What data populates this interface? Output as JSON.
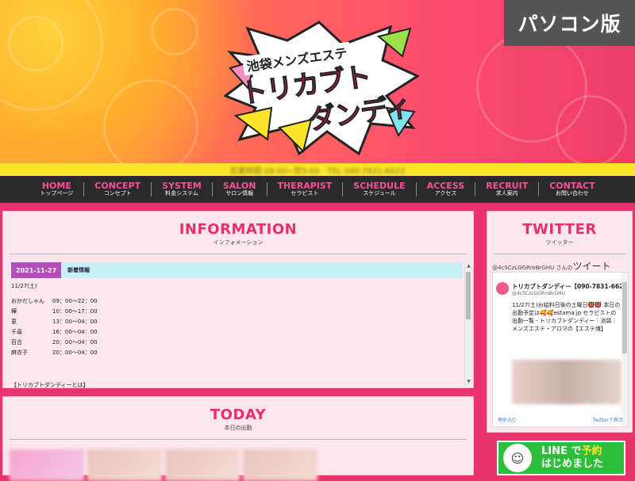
{
  "header": {
    "pc_badge": "パソコン版",
    "logo_sub": "池袋メンズエステ",
    "logo_line1": "トリカブト",
    "logo_line2": "ダンディ",
    "yellow_bar_text": "営業時間 09:00~翌5:00　TEL 090-7831-6622"
  },
  "nav": [
    {
      "en": "HOME",
      "ja": "トップページ"
    },
    {
      "en": "CONCEPT",
      "ja": "コンセプト"
    },
    {
      "en": "SYSTEM",
      "ja": "料金システム"
    },
    {
      "en": "SALON",
      "ja": "サロン情報"
    },
    {
      "en": "THERAPIST",
      "ja": "セラピスト"
    },
    {
      "en": "SCHEDULE",
      "ja": "スケジュール"
    },
    {
      "en": "ACCESS",
      "ja": "アクセス"
    },
    {
      "en": "RECRUIT",
      "ja": "求人案内"
    },
    {
      "en": "CONTACT",
      "ja": "お問い合わせ"
    }
  ],
  "information": {
    "title": "INFORMATION",
    "subtitle": "インフォメーション",
    "news_date": "2021-11-27",
    "news_category": "新着情報",
    "date_line": "11/27(土)",
    "shifts": [
      {
        "name": "おかだしゃん",
        "time": "09：00～22：00"
      },
      {
        "name": "樺",
        "time": "10：00～17：00"
      },
      {
        "name": "恵",
        "time": "13：00～04：00"
      },
      {
        "name": "千尋",
        "time": "16：00～04：00"
      },
      {
        "name": "百合",
        "time": "20：00～04：00"
      },
      {
        "name": "麻衣子",
        "time": "20：00～04：00"
      }
    ],
    "footer_line": "【トリカブトダンディーとは】"
  },
  "today": {
    "title": "TODAY",
    "subtitle": "本日の出勤"
  },
  "twitter": {
    "title": "TWITTER",
    "subtitle": "ツイッター",
    "header_handle": "@4cSCzLGGRmBrGHU さんの",
    "header_big": "ツイート",
    "name": "トリカブトダンディー【090-7831-6622】",
    "handle": "@4cSCzLGGRmBrGHU",
    "text": "11/27(土)お給料日後の土曜日👹👹 本日の出勤予定は🥰🥰estama.jp セラピストの出勤一覧 - トリカブトダンディー｜池袋｜メンズエステ・アロマの【エステ魂】",
    "embed_label": "埋め込む",
    "view_label": "Twitterで表示"
  },
  "line_banner": {
    "line1_a": "LINE",
    "line1_b": "で",
    "line1_c": "予約",
    "line2": "はじめました",
    "face_icon": "☺"
  }
}
